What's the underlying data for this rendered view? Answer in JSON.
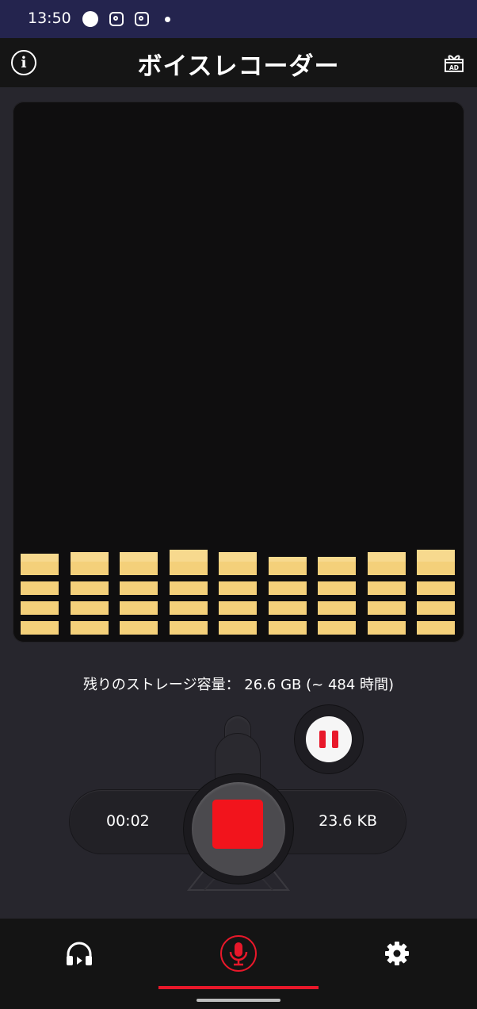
{
  "status_bar": {
    "time": "13:50",
    "icons": [
      "notification-dot-icon",
      "instagram-icon",
      "instagram-icon",
      "small-dot-icon"
    ]
  },
  "app_bar": {
    "title": "ボイスレコーダー",
    "info_icon": "info-icon",
    "ad_icon_label": "AD"
  },
  "visualizer": {
    "bar_color": "#f4d07a",
    "columns": [
      {
        "level": 0.85
      },
      {
        "level": 0.87
      },
      {
        "level": 0.87
      },
      {
        "level": 0.9
      },
      {
        "level": 0.87
      },
      {
        "level": 0.8
      },
      {
        "level": 0.8
      },
      {
        "level": 0.87
      },
      {
        "level": 0.9
      }
    ]
  },
  "storage": {
    "text": "残りのストレージ容量： 26.6 GB (~ 484 時間)"
  },
  "recorder": {
    "elapsed": "00:02",
    "file_size": "23.6 KB",
    "accent": "#f2141c"
  },
  "bottom_nav": {
    "items": [
      {
        "icon": "headphones-icon",
        "active": false
      },
      {
        "icon": "microphone-icon",
        "active": true
      },
      {
        "icon": "gear-icon",
        "active": false
      }
    ]
  }
}
